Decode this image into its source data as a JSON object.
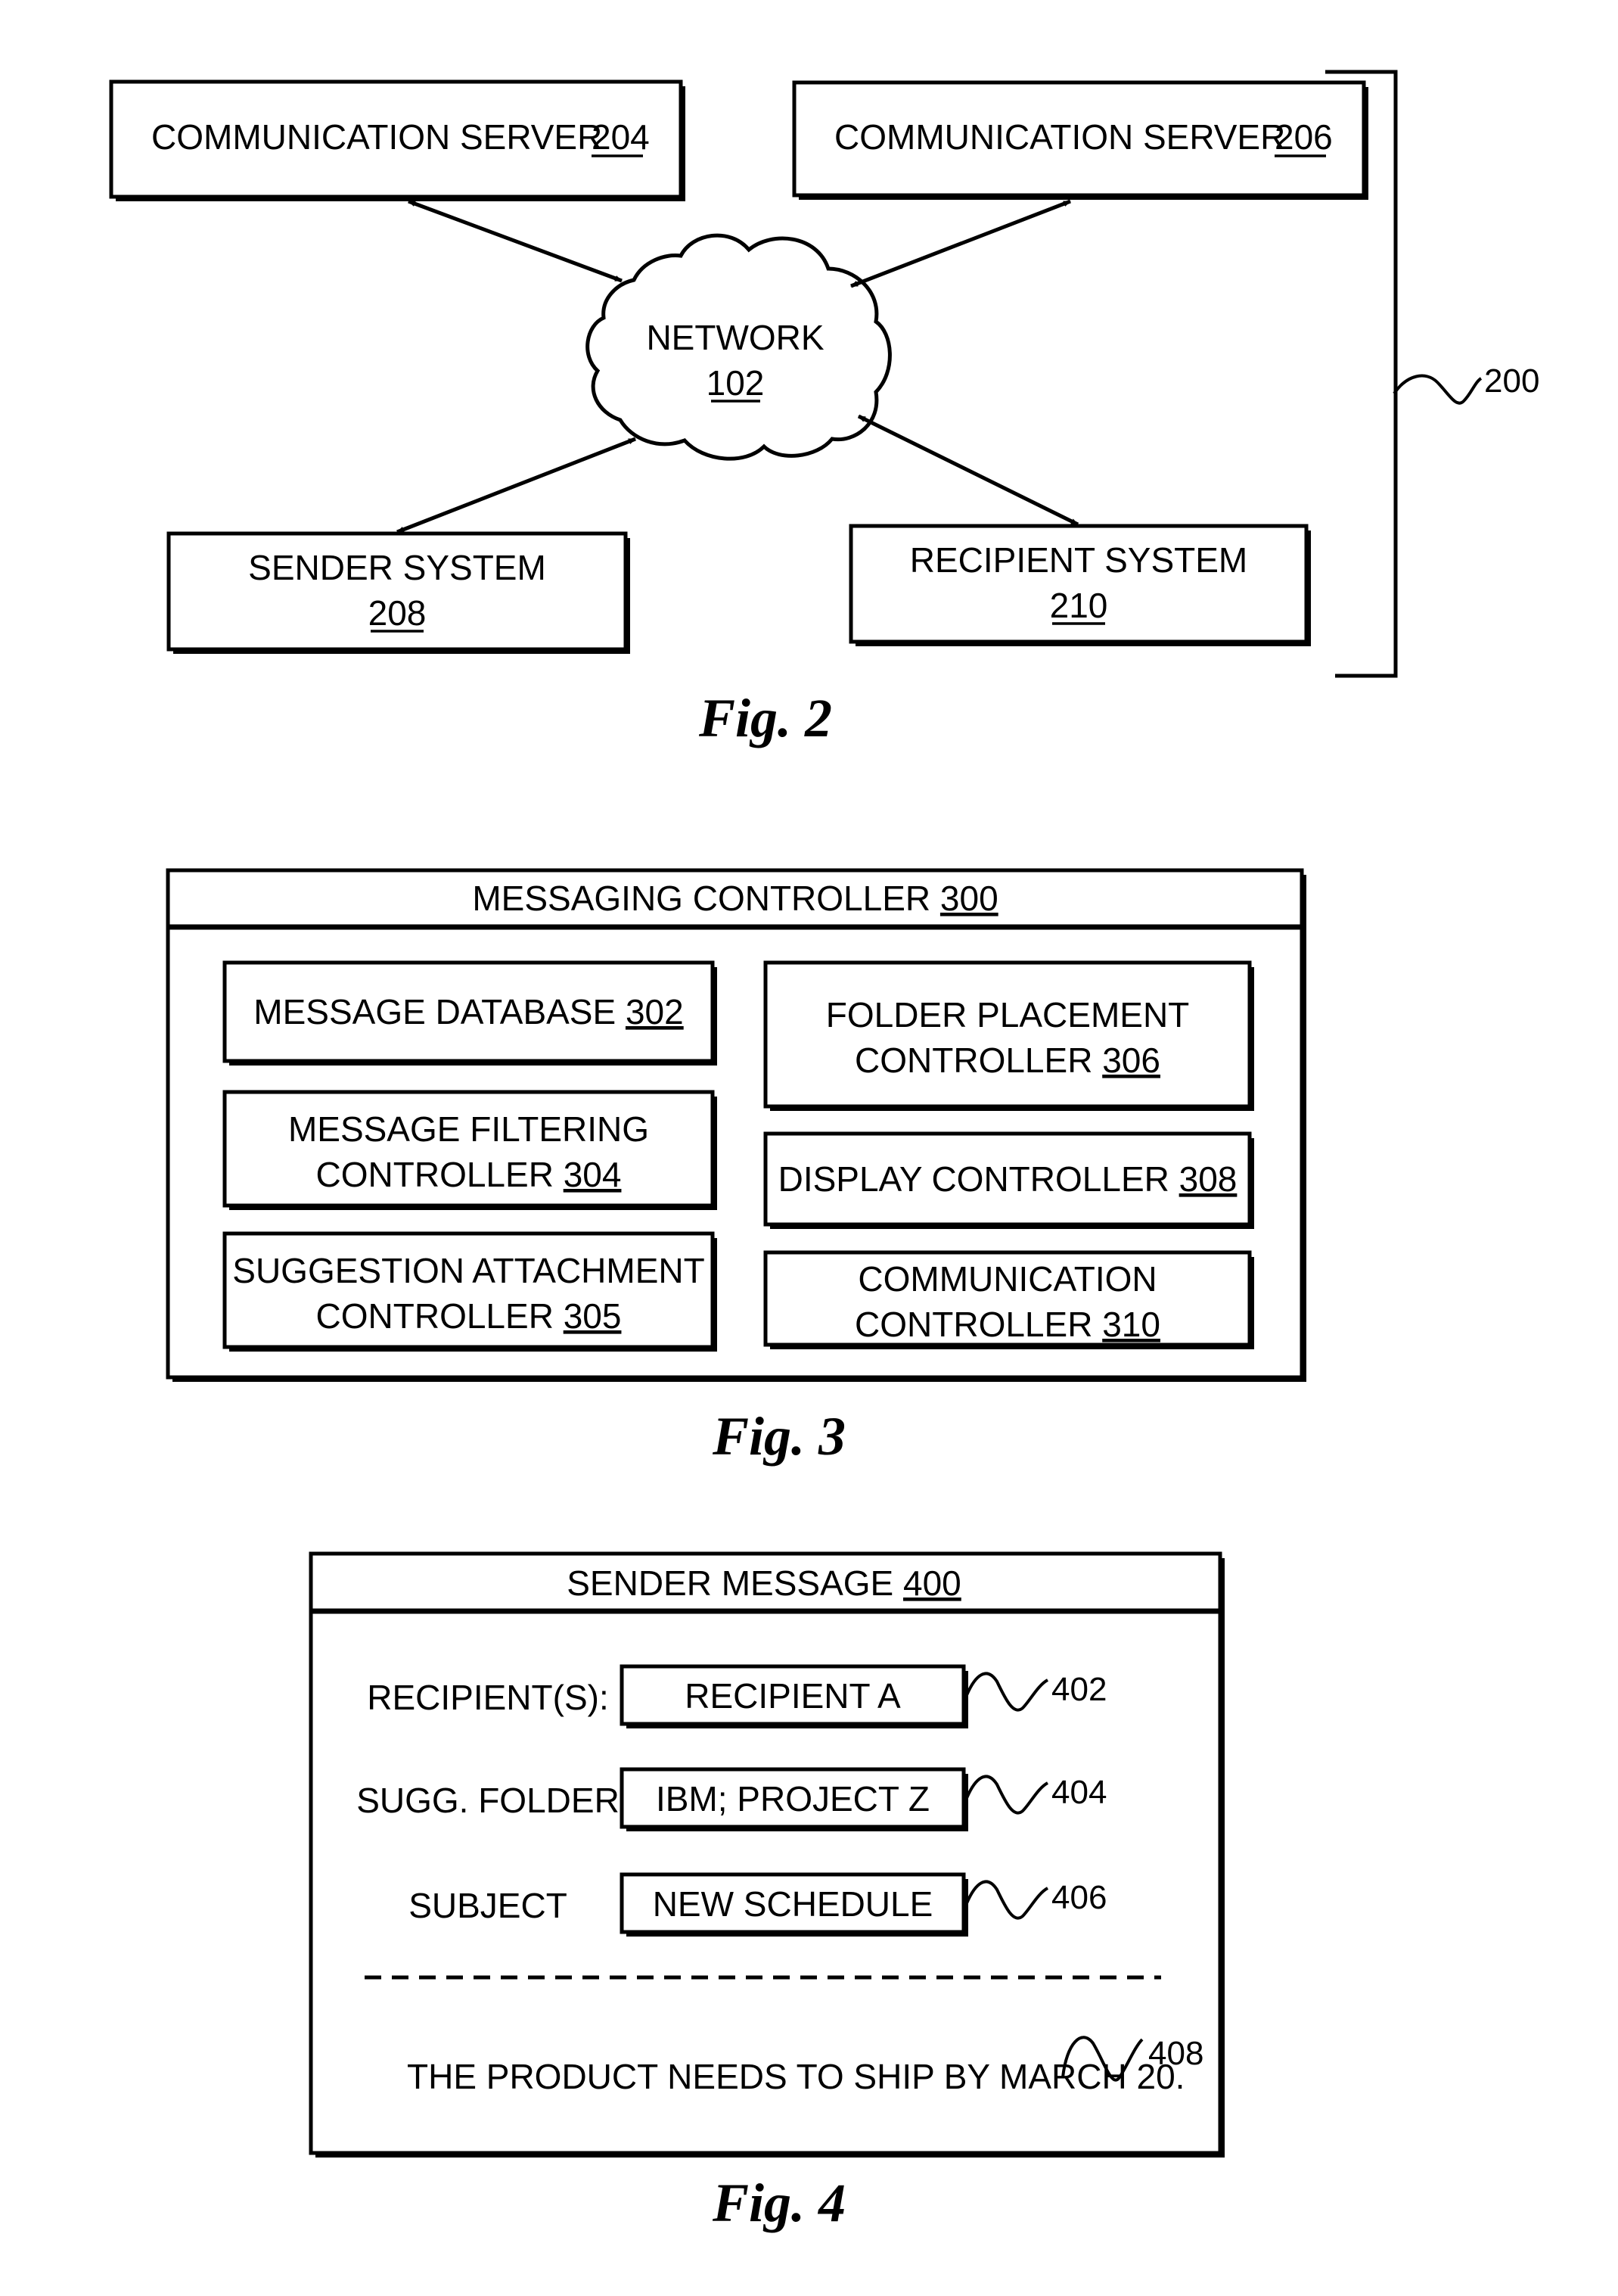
{
  "fig2": {
    "caption": "Fig. 2",
    "system_ref": "200",
    "nodes": {
      "server_a": {
        "label": "COMMUNICATION SERVER",
        "ref": "204"
      },
      "server_b": {
        "label": "COMMUNICATION SERVER",
        "ref": "206"
      },
      "network": {
        "label": "NETWORK",
        "ref": "102"
      },
      "sender": {
        "label": "SENDER SYSTEM",
        "ref": "208"
      },
      "recipient": {
        "label": "RECIPIENT SYSTEM",
        "ref": "210"
      }
    },
    "connections": [
      {
        "from": "server_a",
        "to": "network",
        "bidirectional": true
      },
      {
        "from": "server_b",
        "to": "network",
        "bidirectional": true
      },
      {
        "from": "sender",
        "to": "network",
        "bidirectional": true
      },
      {
        "from": "recipient",
        "to": "network",
        "bidirectional": true
      }
    ]
  },
  "fig3": {
    "caption": "Fig. 3",
    "title": "MESSAGING CONTROLLER",
    "title_ref": "300",
    "components": [
      {
        "line1": "MESSAGE DATABASE",
        "line2": "",
        "ref": "302"
      },
      {
        "line1": "MESSAGE FILTERING",
        "line2": "CONTROLLER",
        "ref": "304"
      },
      {
        "line1": "SUGGESTION ATTACHMENT",
        "line2": "CONTROLLER",
        "ref": "305"
      },
      {
        "line1": "FOLDER PLACEMENT",
        "line2": "CONTROLLER",
        "ref": "306"
      },
      {
        "line1": "DISPLAY CONTROLLER",
        "line2": "",
        "ref": "308"
      },
      {
        "line1": "COMMUNICATION",
        "line2": "CONTROLLER",
        "ref": "310"
      }
    ]
  },
  "fig4": {
    "caption": "Fig. 4",
    "title": "SENDER MESSAGE",
    "title_ref": "400",
    "fields": [
      {
        "label": "RECIPIENT(S):",
        "value": "RECIPIENT A",
        "ref": "402"
      },
      {
        "label": "SUGG. FOLDER",
        "value": "IBM; PROJECT Z",
        "ref": "404"
      },
      {
        "label": "SUBJECT",
        "value": "NEW SCHEDULE",
        "ref": "406"
      }
    ],
    "body": "THE PRODUCT NEEDS TO SHIP BY MARCH 20.",
    "body_ref": "408"
  }
}
